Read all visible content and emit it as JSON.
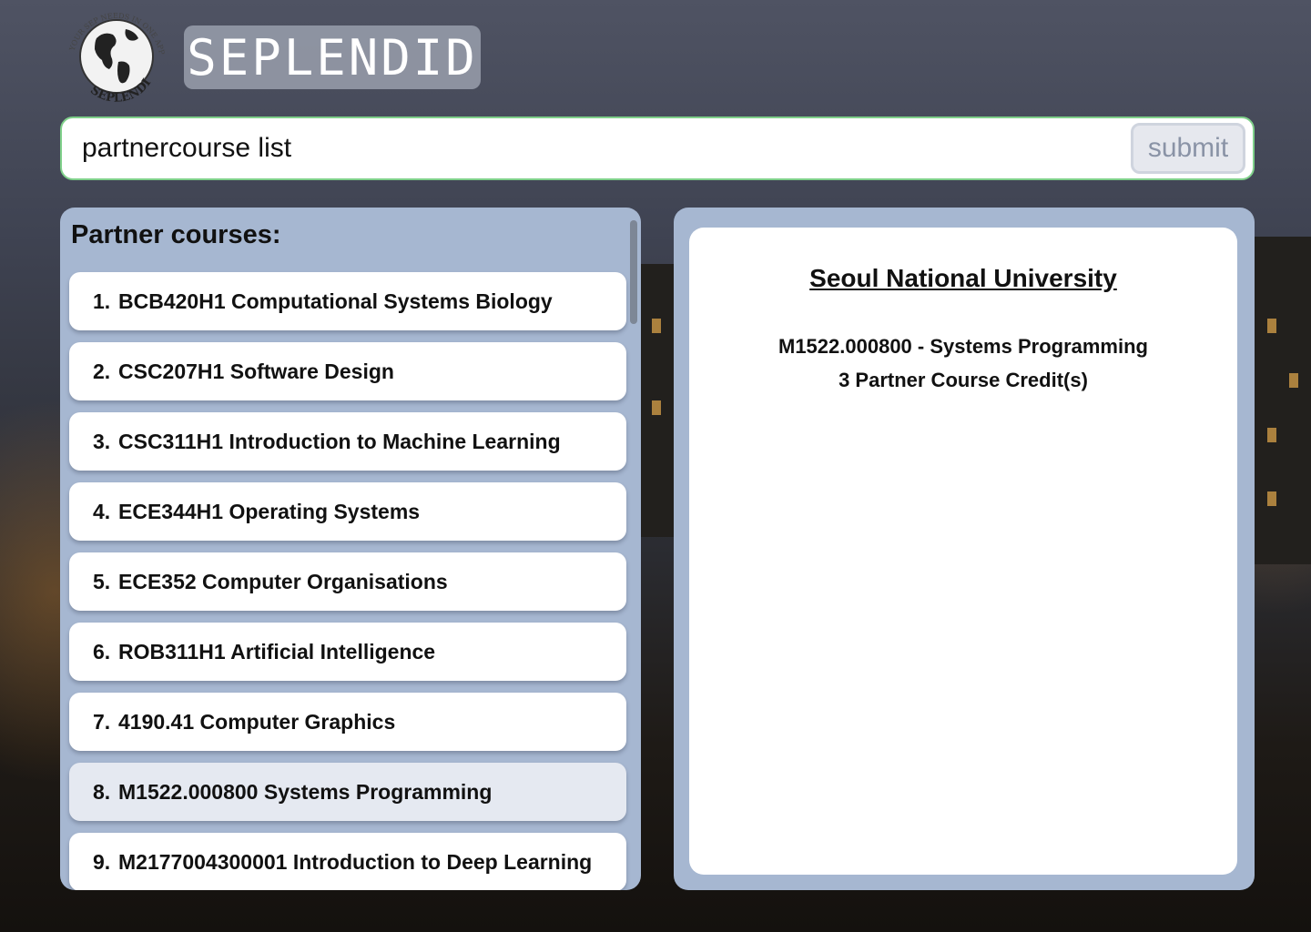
{
  "app": {
    "title": "SEPLENDID",
    "logo_ring_text_top": "YOUR SEP NEEDS IN ONE APP",
    "logo_ring_text_bottom": "SEPLENDID"
  },
  "search": {
    "value": "partnercourse list",
    "submit_label": "submit"
  },
  "left_panel": {
    "title": "Partner courses:",
    "courses": [
      {
        "num": "1.",
        "label": "BCB420H1 Computational Systems Biology"
      },
      {
        "num": "2.",
        "label": "CSC207H1 Software Design"
      },
      {
        "num": "3.",
        "label": "CSC311H1 Introduction to Machine Learning"
      },
      {
        "num": "4.",
        "label": "ECE344H1 Operating Systems"
      },
      {
        "num": "5.",
        "label": "ECE352 Computer Organisations"
      },
      {
        "num": "6.",
        "label": "ROB311H1 Artificial Intelligence"
      },
      {
        "num": "7.",
        "label": "4190.41 Computer Graphics"
      },
      {
        "num": "8.",
        "label": "M1522.000800 Systems Programming"
      },
      {
        "num": "9.",
        "label": "M2177004300001 Introduction to Deep Learning"
      }
    ],
    "selected_index": 7
  },
  "detail": {
    "university": "Seoul National University",
    "course_line": "M1522.000800 - Systems Programming",
    "credits_line": "3 Partner Course Credit(s)"
  },
  "colors": {
    "panel_bg": "#a6b7d1",
    "search_border": "#7fd08a",
    "selected_item_bg": "#e5e9f1"
  }
}
